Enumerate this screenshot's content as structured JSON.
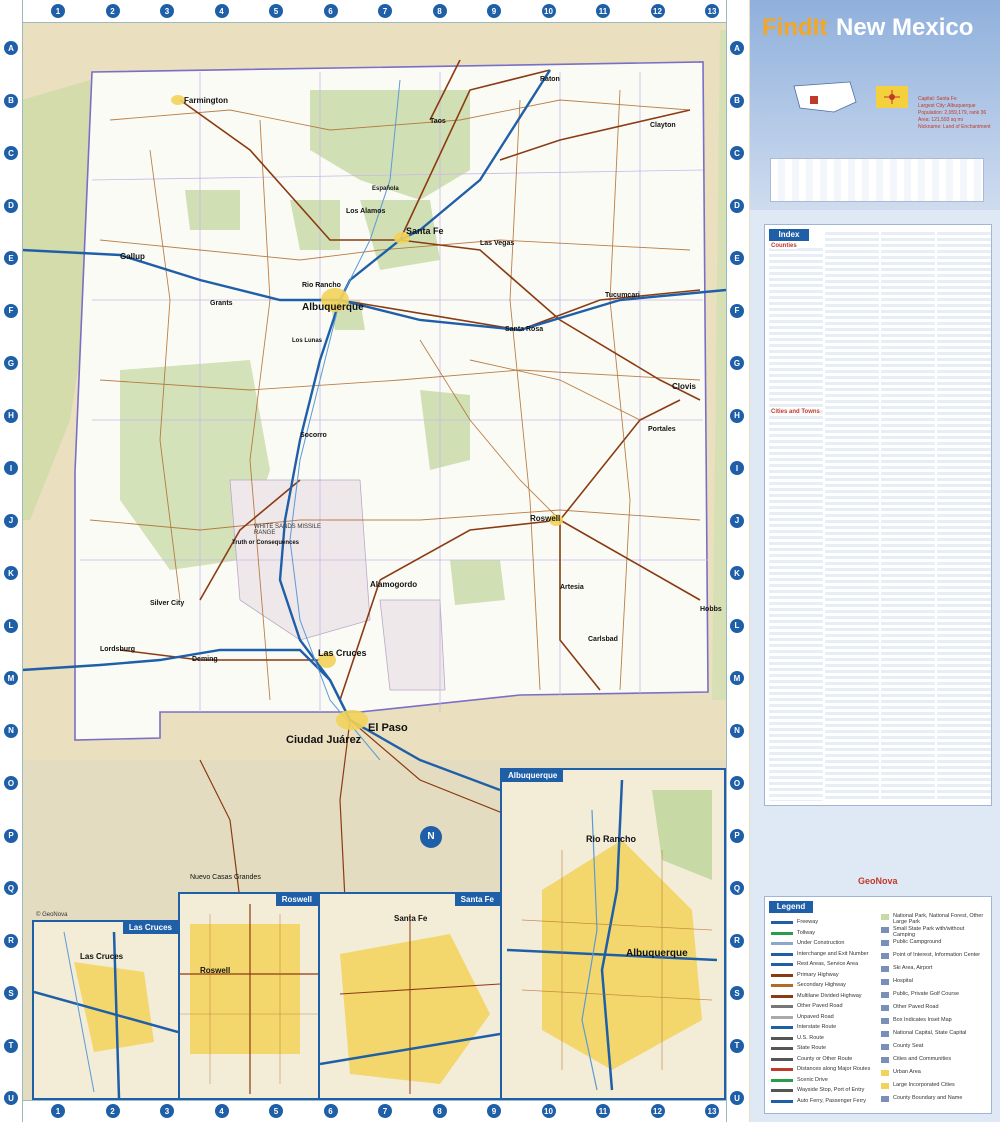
{
  "header": {
    "brand": "FindIt",
    "state": "New Mexico"
  },
  "facts": {
    "capital": "Capital: Santa Fe",
    "largest_city": "Largest City: Albuquerque",
    "population": "Population: 2,059,179, rank 36",
    "area": "Area: 121,593 sq mi",
    "nickname": "Nickname: Land of Enchantment"
  },
  "index": {
    "title": "Index",
    "counties": "Counties",
    "cities": "Cities and Towns"
  },
  "legend": {
    "title": "Legend",
    "items": [
      {
        "label": "Freeway",
        "color": "#1f5fa8"
      },
      {
        "label": "Tollway",
        "color": "#2a9d4a"
      },
      {
        "label": "Under Construction",
        "color": "#8fa6c9"
      },
      {
        "label": "Interchange and Exit Number",
        "color": "#1f5fa8"
      },
      {
        "label": "Rest Areas, Service Area",
        "color": "#1f5fa8"
      },
      {
        "label": "Primary Highway",
        "color": "#8a3b12"
      },
      {
        "label": "Secondary Highway",
        "color": "#b06a2a"
      },
      {
        "label": "Multilane Divided Highway",
        "color": "#8a3b12"
      },
      {
        "label": "Other Paved Road",
        "color": "#777777"
      },
      {
        "label": "Unpaved Road",
        "color": "#aaaaaa"
      },
      {
        "label": "Interstate Route",
        "color": "#1f5fa8"
      },
      {
        "label": "U.S. Route",
        "color": "#555555"
      },
      {
        "label": "State Route",
        "color": "#555555"
      },
      {
        "label": "County or Other Route",
        "color": "#555555"
      },
      {
        "label": "Distances along Major Routes",
        "color": "#c0392b"
      },
      {
        "label": "Scenic Drive",
        "color": "#2a9d4a"
      },
      {
        "label": "Wayside Stop, Port of Entry",
        "color": "#555555"
      },
      {
        "label": "Auto Ferry, Passenger Ferry",
        "color": "#1f5fa8"
      }
    ],
    "items_right": [
      "National Park, National Forest, Other Large Park",
      "Small State Park with/without Camping",
      "Public Campground",
      "Point of Interest, Information Center",
      "Ski Area, Airport",
      "Hospital",
      "Public, Private Golf Course",
      "Other Paved Road",
      "Box Indicates Inset Map",
      "National Capital, State Capital",
      "County Seat",
      "Cities and Communities",
      "Urban Area",
      "Large Incorporated Cities",
      "County Boundary and Name"
    ]
  },
  "insets": {
    "las_cruces": "Las Cruces",
    "roswell": "Roswell",
    "santa_fe": "Santa Fe",
    "albuquerque": "Albuquerque"
  },
  "labels": {
    "albuquerque": "Albuquerque",
    "santa_fe": "Santa Fe",
    "las_cruces": "Las Cruces",
    "el_paso": "El Paso",
    "ciudad_juarez": "Ciudad Juárez",
    "roswell": "Roswell",
    "farmington": "Farmington",
    "gallup": "Gallup",
    "rio_rancho": "Rio Rancho",
    "los_alamos": "Los Alamos",
    "las_vegas": "Las Vegas",
    "clovis": "Clovis",
    "portales": "Portales",
    "hobbs": "Hobbs",
    "carlsbad": "Carlsbad",
    "artesia": "Artesia",
    "alamogordo": "Alamogordo",
    "deming": "Deming",
    "lordsburg": "Lordsburg",
    "silver_city": "Silver City",
    "socorro": "Socorro",
    "tucumcari": "Tucumcari",
    "santa_rosa": "Santa Rosa",
    "raton": "Raton",
    "taos": "Taos",
    "clayton": "Clayton",
    "grants": "Grants",
    "truth_or_consequences": "Truth or Consequences",
    "los_lunas": "Los Lunas",
    "espanola": "Española",
    "nuevo_casas_grandes": "Nuevo Casas Grandes",
    "white_sands": "WHITE SANDS MISSILE RANGE",
    "insets_abq_rio_rancho": "Rio Rancho",
    "insets_abq_label": "Albuquerque",
    "insets_roswell_label": "Roswell",
    "insets_lc_label": "Las Cruces",
    "insets_sf_label": "Santa Fe",
    "copyright": "© GeoNova",
    "geonova": "GeoNova"
  },
  "grid": {
    "cols": [
      "1",
      "2",
      "3",
      "4",
      "5",
      "6",
      "7",
      "8",
      "9",
      "10",
      "11",
      "12",
      "13"
    ],
    "rows": [
      "A",
      "B",
      "C",
      "D",
      "E",
      "F",
      "G",
      "H",
      "I",
      "J",
      "K",
      "L",
      "M",
      "N",
      "O",
      "P",
      "Q",
      "R",
      "S",
      "T",
      "U"
    ]
  },
  "colors": {
    "state_interior": "#fbfbf6",
    "outside": "#eadfbe",
    "forest": "#c7d9a4",
    "freeway": "#1f5fa8",
    "highway": "#8a3b12",
    "boundary": "#7a6fc6",
    "urban": "#f2d35a"
  }
}
